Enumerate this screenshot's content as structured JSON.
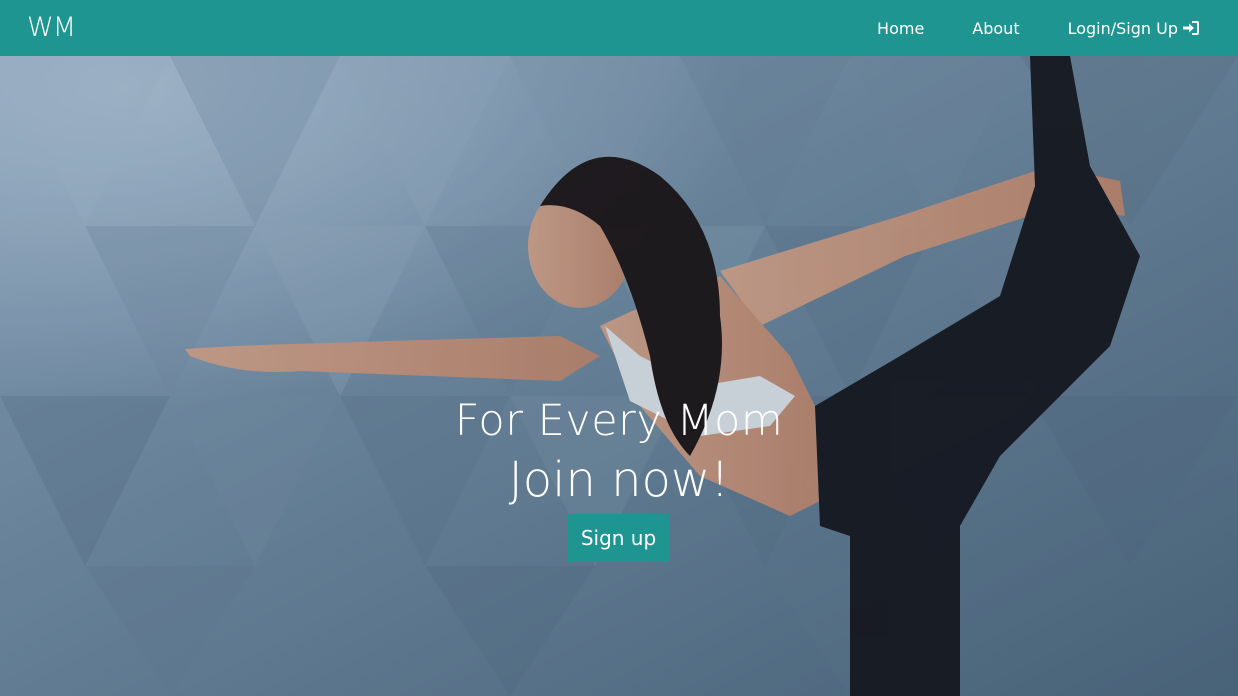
{
  "navbar": {
    "brand": "WM",
    "links": [
      {
        "label": "Home"
      },
      {
        "label": "About"
      },
      {
        "label": "Login/Sign Up"
      }
    ],
    "login_icon": "sign-in-icon",
    "color": "#1e9590"
  },
  "hero": {
    "tagline": "For Every Mom",
    "heading": "Join now!",
    "button_label": "Sign up",
    "button_color": "#1e9590"
  }
}
